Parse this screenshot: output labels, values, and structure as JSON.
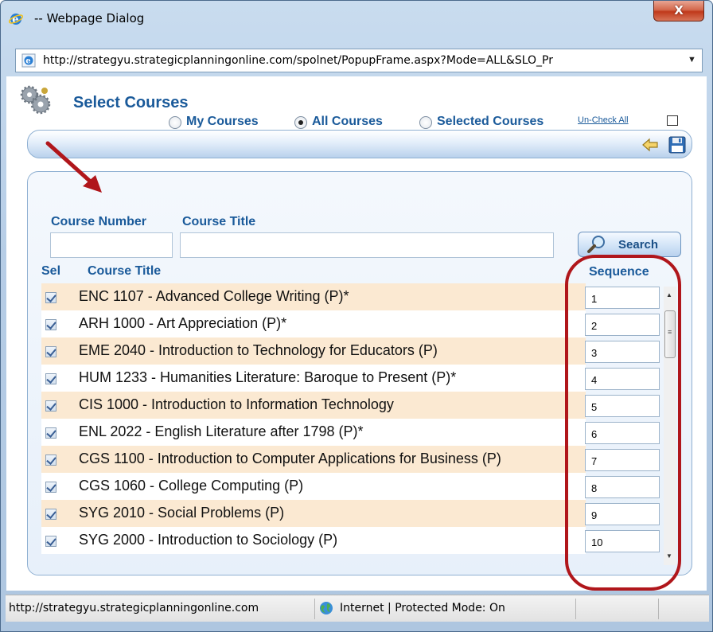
{
  "window": {
    "title": "-- Webpage Dialog",
    "close_label": "X",
    "address": "http://strategyu.strategicplanningonline.com/spolnet/PopupFrame.aspx?Mode=ALL&SLO_Pr"
  },
  "page": {
    "title": "Select Courses"
  },
  "filters": {
    "options": [
      {
        "label": "My Courses",
        "checked": false
      },
      {
        "label": "All Courses",
        "checked": true
      },
      {
        "label": "Selected Courses",
        "checked": false
      }
    ],
    "uncheck_all_label": "Un-Check All"
  },
  "search": {
    "course_number_label": "Course Number",
    "course_title_label": "Course Title",
    "course_number_value": "",
    "course_title_value": "",
    "button_label": "Search"
  },
  "table": {
    "headers": {
      "sel": "Sel",
      "title": "Course Title",
      "sequence": "Sequence"
    },
    "rows": [
      {
        "title": "ENC 1107 - Advanced College Writing (P)*",
        "sequence": "1",
        "checked": true
      },
      {
        "title": "ARH 1000 - Art Appreciation (P)*",
        "sequence": "2",
        "checked": true
      },
      {
        "title": "EME 2040 - Introduction to Technology for Educators (P)",
        "sequence": "3",
        "checked": true
      },
      {
        "title": "HUM 1233 - Humanities Literature: Baroque to Present (P)*",
        "sequence": "4",
        "checked": true
      },
      {
        "title": "CIS 1000 - Introduction to Information Technology",
        "sequence": "5",
        "checked": true
      },
      {
        "title": "ENL 2022 - English Literature after 1798 (P)*",
        "sequence": "6",
        "checked": true
      },
      {
        "title": "CGS 1100 - Introduction to Computer Applications for Business (P)",
        "sequence": "7",
        "checked": true
      },
      {
        "title": "CGS 1060 - College Computing (P)",
        "sequence": "8",
        "checked": true
      },
      {
        "title": "SYG 2010 - Social Problems (P)",
        "sequence": "9",
        "checked": true
      },
      {
        "title": "SYG 2000 - Introduction to Sociology (P)",
        "sequence": "10",
        "checked": true
      }
    ]
  },
  "status_bar": {
    "url": "http://strategyu.strategicplanningonline.com",
    "zone": "Internet | Protected Mode: On"
  },
  "colors": {
    "accent": "#1a5a9a",
    "row_highlight": "#fbe9d2",
    "annotation": "#b0161b"
  },
  "icons": [
    "ie-icon",
    "close-icon",
    "gears-icon",
    "back-icon",
    "save-icon",
    "search-icon",
    "globe-icon",
    "chevron-down-icon"
  ]
}
